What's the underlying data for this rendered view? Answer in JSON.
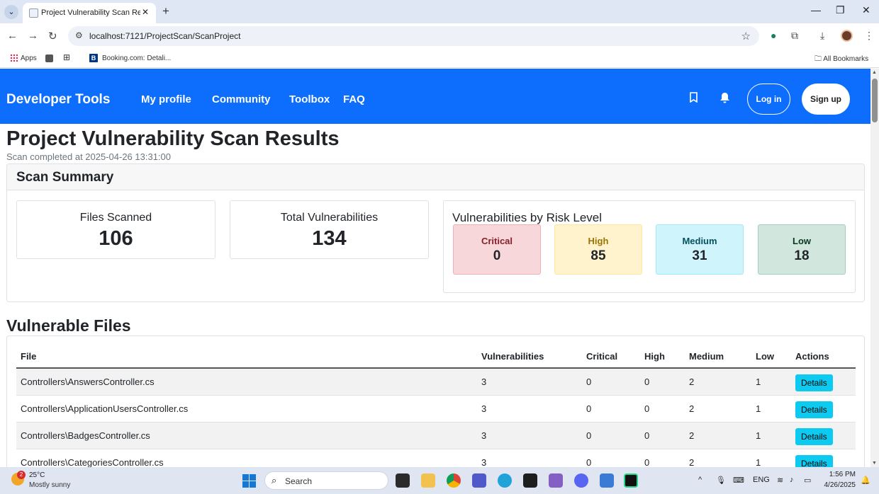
{
  "browser": {
    "tab_title": "Project Vulnerability Scan Resul",
    "url": "localhost:7121/ProjectScan/ScanProject",
    "bookmarks": {
      "apps": "Apps",
      "booking": "Booking.com: Detali...",
      "all": "All Bookmarks"
    }
  },
  "navbar": {
    "brand": "Developer Tools",
    "links": [
      "My profile",
      "Community",
      "Toolbox",
      "FAQ"
    ],
    "login": "Log in",
    "signup": "Sign up"
  },
  "page": {
    "title": "Project Vulnerability Scan Results",
    "subtitle": "Scan completed at 2025-04-26 13:31:00"
  },
  "summary": {
    "title": "Scan Summary",
    "files_label": "Files Scanned",
    "files_value": "106",
    "total_label": "Total Vulnerabilities",
    "total_value": "134",
    "risk_title": "Vulnerabilities by Risk Level",
    "risks": [
      {
        "label": "Critical",
        "value": "0"
      },
      {
        "label": "High",
        "value": "85"
      },
      {
        "label": "Medium",
        "value": "31"
      },
      {
        "label": "Low",
        "value": "18"
      }
    ]
  },
  "files": {
    "title": "Vulnerable Files",
    "columns": [
      "File",
      "Vulnerabilities",
      "Critical",
      "High",
      "Medium",
      "Low",
      "Actions"
    ],
    "details_label": "Details",
    "rows": [
      {
        "file": "Controllers\\AnswersController.cs",
        "vulns": "3",
        "critical": "0",
        "high": "0",
        "medium": "2",
        "low": "1"
      },
      {
        "file": "Controllers\\ApplicationUsersController.cs",
        "vulns": "3",
        "critical": "0",
        "high": "0",
        "medium": "2",
        "low": "1"
      },
      {
        "file": "Controllers\\BadgesController.cs",
        "vulns": "3",
        "critical": "0",
        "high": "0",
        "medium": "2",
        "low": "1"
      },
      {
        "file": "Controllers\\CategoriesController.cs",
        "vulns": "3",
        "critical": "0",
        "high": "0",
        "medium": "2",
        "low": "1"
      }
    ]
  },
  "taskbar": {
    "temp": "25°C",
    "weather": "Mostly sunny",
    "weather_badge": "2",
    "search_placeholder": "Search",
    "lang": "ENG",
    "time": "1:56 PM",
    "date": "4/26/2025"
  },
  "colors": {
    "navbar": "#0d6efd",
    "critical_bg": "#f8d7da",
    "high_bg": "#fff3cd",
    "medium_bg": "#cff4fc",
    "low_bg": "#d1e7dd",
    "details_btn": "#0dcaf0"
  }
}
